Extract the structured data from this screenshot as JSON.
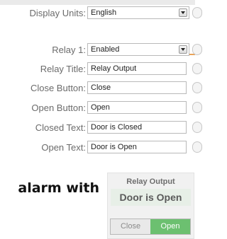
{
  "form": {
    "display_units": {
      "label": "Display Units:",
      "value": "English"
    },
    "relay": {
      "label": "Relay 1:",
      "value": "Enabled"
    },
    "relay_title": {
      "label": "Relay Title:",
      "value": "Relay Output"
    },
    "close_button": {
      "label": "Close Button:",
      "value": "Close"
    },
    "open_button": {
      "label": "Open Button:",
      "value": "Open"
    },
    "closed_text": {
      "label": "Closed Text:",
      "value": "Door is Closed"
    },
    "open_text": {
      "label": "Open Text:",
      "value": "Door is Open"
    }
  },
  "cutoff_text": "alarm with",
  "widget": {
    "title": "Relay Output",
    "status": "Door is Open",
    "close_label": "Close",
    "open_label": "Open"
  },
  "colors": {
    "accent_orange": "#e8a35a",
    "open_active": "#6cc070",
    "status_bg": "#e7efe7"
  }
}
